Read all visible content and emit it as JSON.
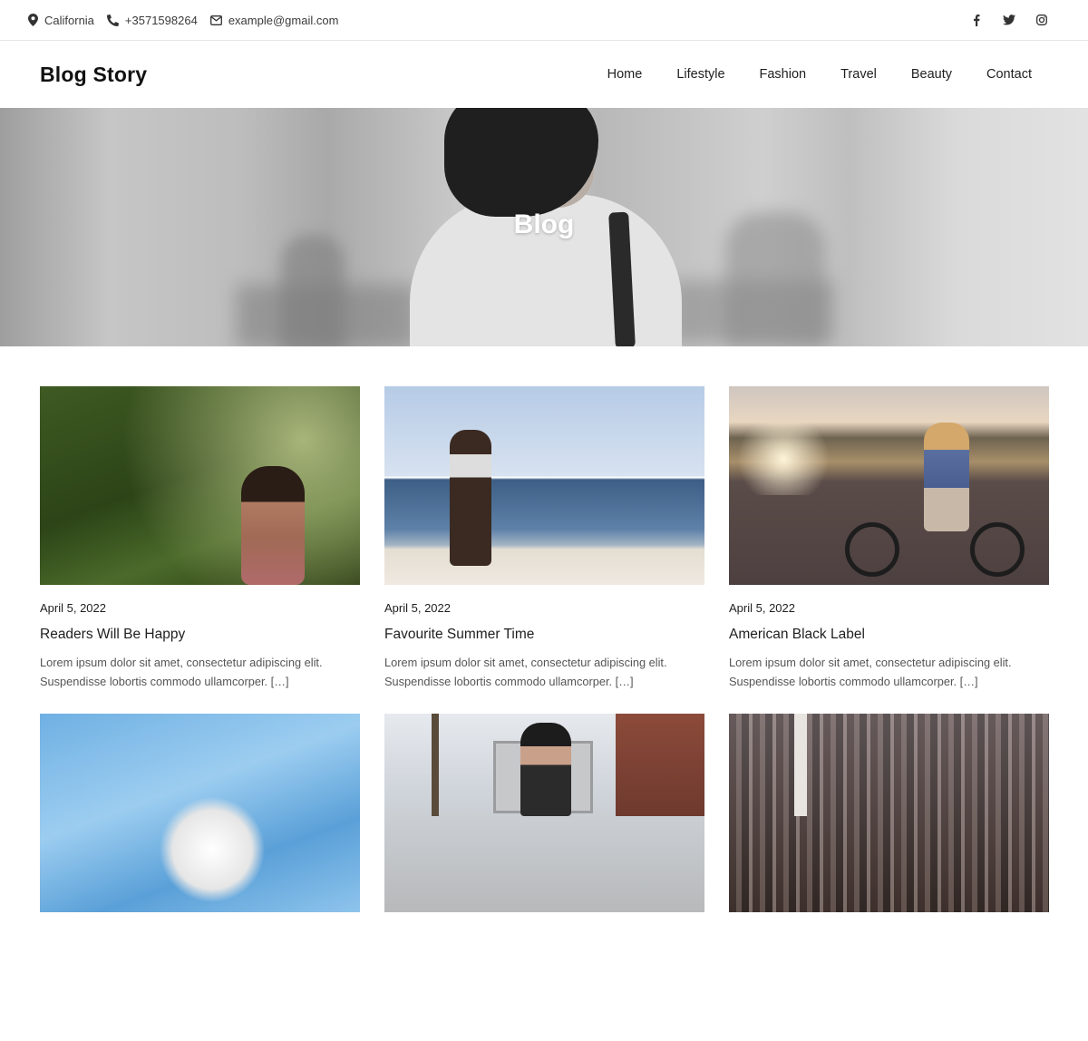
{
  "topbar": {
    "location": "California",
    "phone": "+3571598264",
    "email": "example@gmail.com",
    "social": [
      {
        "icon": "facebook-icon"
      },
      {
        "icon": "twitter-icon"
      },
      {
        "icon": "instagram-icon"
      }
    ]
  },
  "header": {
    "logo": "Blog Story",
    "nav": [
      "Home",
      "Lifestyle",
      "Fashion",
      "Travel",
      "Beauty",
      "Contact"
    ]
  },
  "hero": {
    "title": "Blog"
  },
  "posts": [
    {
      "date": "April 5, 2022",
      "title": "Readers Will Be Happy",
      "excerpt": "Lorem ipsum dolor sit amet, consectetur adipiscing elit. Suspendisse lobortis commodo ullamcorper. […]"
    },
    {
      "date": "April 5, 2022",
      "title": "Favourite Summer Time",
      "excerpt": "Lorem ipsum dolor sit amet, consectetur adipiscing elit. Suspendisse lobortis commodo ullamcorper. […]"
    },
    {
      "date": "April 5, 2022",
      "title": "American Black Label",
      "excerpt": "Lorem ipsum dolor sit amet, consectetur adipiscing elit. Suspendisse lobortis commodo ullamcorper. […]"
    }
  ],
  "colors": {
    "text": "#1f1f1f",
    "muted": "#555555",
    "divider": "#e6e6e6",
    "hero_title": "#ffffff"
  }
}
